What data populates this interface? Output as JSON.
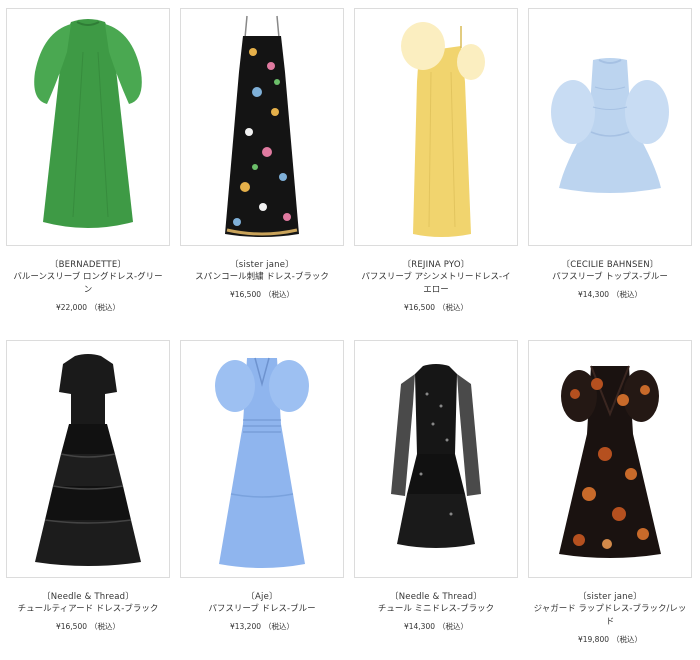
{
  "products": [
    {
      "brand": "〔BERNADETTE〕",
      "name": "バルーンスリーブ ロングドレス-グリーン",
      "price": "¥22,000",
      "tax": "（税込）",
      "colors": {
        "main": "#3e9a45",
        "accent": "#2f7d36"
      },
      "icon": "dress-balloon-sleeve"
    },
    {
      "brand": "〔sister jane〕",
      "name": "スパンコール刺繍 ドレス-ブラック",
      "price": "¥16,500",
      "tax": "（税込）",
      "colors": {
        "main": "#141414",
        "accent": "#c9a35a"
      },
      "icon": "dress-slip-floral"
    },
    {
      "brand": "〔REJINA PYO〕",
      "name": "パフスリーブ アシンメトリードレス-イエロー",
      "price": "¥16,500",
      "tax": "（税込）",
      "colors": {
        "main": "#f1d46e",
        "accent": "#fbeec0"
      },
      "icon": "dress-asymmetric"
    },
    {
      "brand": "〔CECILIE BAHNSEN〕",
      "name": "パフスリーブ トップス-ブルー",
      "price": "¥14,300",
      "tax": "（税込）",
      "colors": {
        "main": "#bcd4ef",
        "accent": "#a6c1e3"
      },
      "icon": "top-puff-sleeve"
    },
    {
      "brand": "〔Needle & Thread〕",
      "name": "チュールティアード ドレス-ブラック",
      "price": "¥16,500",
      "tax": "（税込）",
      "colors": {
        "main": "#111111",
        "accent": "#333333"
      },
      "icon": "dress-tiered-tulle"
    },
    {
      "brand": "〔Aje〕",
      "name": "パフスリーブ ドレス-ブルー",
      "price": "¥13,200",
      "tax": "（税込）",
      "colors": {
        "main": "#8fb5ee",
        "accent": "#7aa2dd"
      },
      "icon": "dress-puff-sleeve"
    },
    {
      "brand": "〔Needle & Thread〕",
      "name": "チュール ミニドレス-ブラック",
      "price": "¥14,300",
      "tax": "（税込）",
      "colors": {
        "main": "#121212",
        "accent": "#3a3a3a"
      },
      "icon": "dress-mini-tulle"
    },
    {
      "brand": "〔sister jane〕",
      "name": "ジャガード ラップドレス-ブラック/レッド",
      "price": "¥19,800",
      "tax": "（税込）",
      "colors": {
        "main": "#1a1210",
        "accent": "#b5501f"
      },
      "icon": "dress-wrap-jacquard"
    }
  ]
}
